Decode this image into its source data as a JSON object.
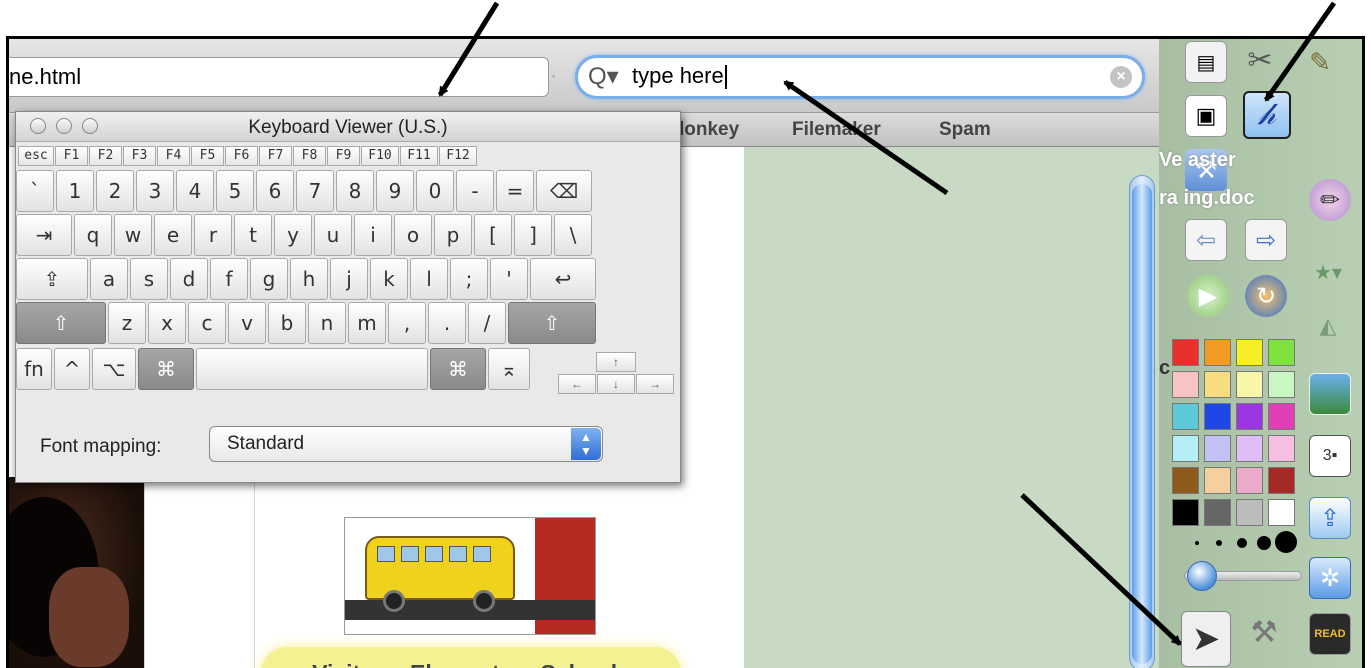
{
  "browser": {
    "url_fragment": "ne.html",
    "search_value": "type here",
    "bookmarks": [
      "lonkey",
      "Filemaker",
      "Spam"
    ]
  },
  "page": {
    "link_text": "Visit our Elementary Schools",
    "peek_text_1": "Ve aster",
    "peek_text_2": "ra ing.doc",
    "peek_text_3": "c"
  },
  "keyboard_viewer": {
    "title": "Keyboard Viewer (U.S.)",
    "function_keys": [
      "esc",
      "F1",
      "F2",
      "F3",
      "F4",
      "F5",
      "F6",
      "F7",
      "F8",
      "F9",
      "F10",
      "F11",
      "F12"
    ],
    "row_number": [
      "`",
      "1",
      "2",
      "3",
      "4",
      "5",
      "6",
      "7",
      "8",
      "9",
      "0",
      "-",
      "=",
      "⌫"
    ],
    "row_top": [
      "⇥",
      "q",
      "w",
      "e",
      "r",
      "t",
      "y",
      "u",
      "i",
      "o",
      "p",
      "[",
      "]",
      "\\"
    ],
    "row_home": [
      "⇪",
      "a",
      "s",
      "d",
      "f",
      "g",
      "h",
      "j",
      "k",
      "l",
      ";",
      "'",
      "↩"
    ],
    "row_bottom": [
      "⇧",
      "z",
      "x",
      "c",
      "v",
      "b",
      "n",
      "m",
      ",",
      ".",
      "/",
      "⇧"
    ],
    "row_space": [
      "fn",
      "^",
      "⌥",
      "⌘",
      "",
      "⌘",
      "⌅"
    ],
    "arrows": [
      "↑",
      "←",
      "↓",
      "→"
    ],
    "font_mapping_label": "Font mapping:",
    "font_mapping_value": "Standard"
  },
  "palette": {
    "colors": [
      "#e8312a",
      "#f29a21",
      "#f6ee26",
      "#7fe23c",
      "#f7c3c3",
      "#f7dc80",
      "#f8f6a8",
      "#c9f6c2",
      "#5bc9d8",
      "#1e48e6",
      "#9b36e0",
      "#e03fb6",
      "#b6eef6",
      "#c2c2f6",
      "#dfbdf6",
      "#f6bfe1",
      "#8e5a1c",
      "#f5cf9d",
      "#e9abc9",
      "#a52a26",
      "#000000",
      "#666666",
      "#bcbcbc",
      "#ffffff"
    ]
  }
}
